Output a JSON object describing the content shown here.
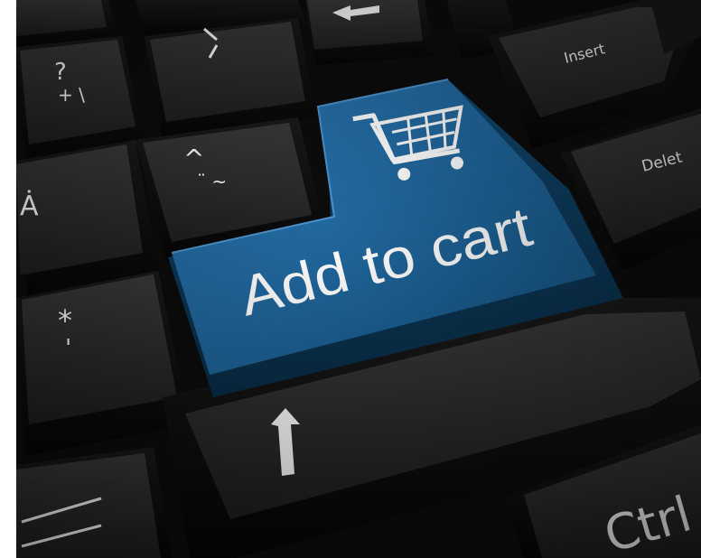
{
  "scene": {
    "description_free_note": "",
    "keys": {
      "question_legend": "?",
      "plus_backslash_legend": "+ \\",
      "backtick_legend": "`",
      "caret_legend": "^",
      "umlaut_tilde_legend": "¨ ~",
      "a_dot_legend": "Ȧ",
      "asterisk_legend": "*",
      "apostrophe_legend": "'",
      "insert_label": "Insert",
      "delete_label": "Delet",
      "ctrl_label": "Ctrl"
    },
    "add_to_cart_key": {
      "label": "Add to cart",
      "icon": "shopping-cart-icon",
      "color": "#1f5f93"
    },
    "colors": {
      "key_face": "#2a2a2a",
      "key_side": "#121212",
      "background": "#0c0c0c",
      "legend": "#ffffff"
    }
  }
}
